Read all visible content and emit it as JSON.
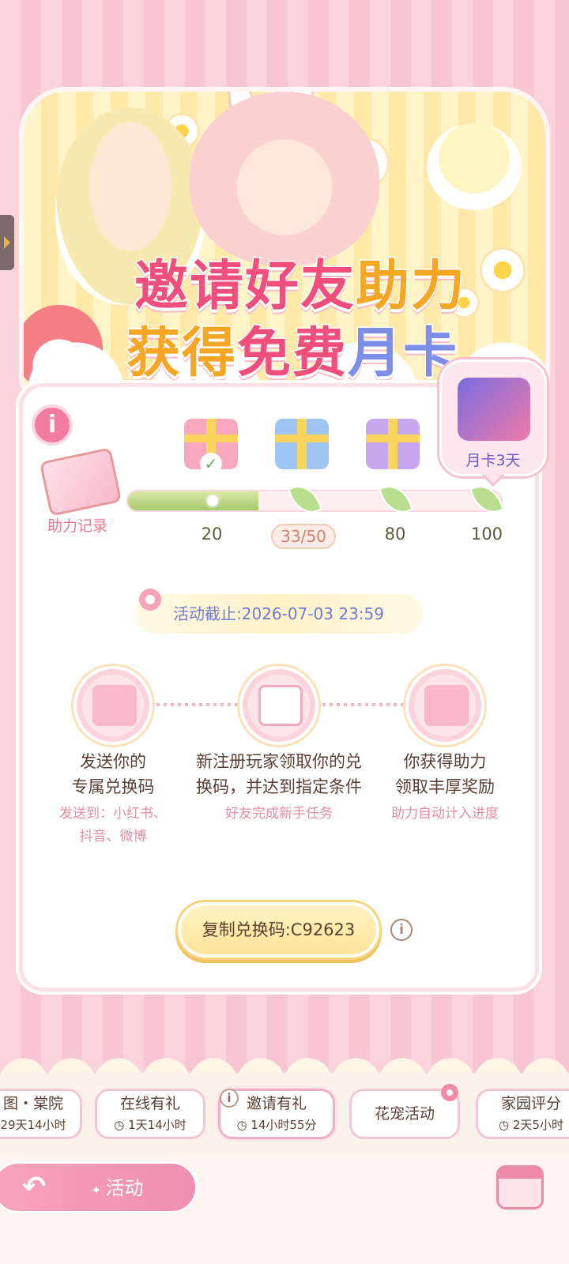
{
  "banner": {
    "title_line1_a": "邀请好友",
    "title_line1_b": "助力",
    "title_line2_a": "获得",
    "title_line2_b": "免费",
    "title_line2_c": "月卡"
  },
  "card": {
    "info_icon": "i",
    "record_label": "助力记录",
    "month_card_label": "月卡3天",
    "progress": {
      "current": 33,
      "goal": 50,
      "max": 100,
      "fill_fraction": 0.35
    },
    "milestones": [
      "20",
      "33/50",
      "80",
      "100"
    ],
    "deadline": "活动截止:2026-07-03 23:59",
    "steps": [
      {
        "title_line1": "发送你的",
        "title_line2": "专属兑换码",
        "sub_line1": "发送到：小红书、",
        "sub_line2": "抖音、微博"
      },
      {
        "title_line1": "新注册玩家领取你的兑",
        "title_line2": "换码，并达到指定条件",
        "sub_line1": "好友完成新手任务",
        "sub_line2": ""
      },
      {
        "title_line1": "你获得助力",
        "title_line2": "领取丰厚奖励",
        "sub_line1": "助力自动计入进度",
        "sub_line2": ""
      }
    ],
    "copy_button": "复制兑换码:C92623",
    "copy_info": "i",
    "check_mark": "✓"
  },
  "tabs": [
    {
      "title": "图・棠院",
      "timer": "29天14小时"
    },
    {
      "title": "在线有礼",
      "timer": "◷ 1天14小时"
    },
    {
      "title": "邀请有礼",
      "timer": "◷ 14小时55分"
    },
    {
      "title": "花宠活动",
      "timer": ""
    },
    {
      "title": "家园评分",
      "timer": "◷ 2天5小时"
    }
  ],
  "tab_info": "i",
  "bottom": {
    "back_icon": "↶",
    "activity_label": "活动"
  },
  "colors": {
    "accent_pink": "#ef4f7a",
    "gold": "#f5a623",
    "lavender": "#7c8ee8"
  },
  "icons": [
    "info-icon",
    "gift-icon",
    "leaf-icon",
    "check-icon",
    "clock-icon",
    "back-arrow-icon",
    "calendar-icon",
    "flower-icon"
  ]
}
